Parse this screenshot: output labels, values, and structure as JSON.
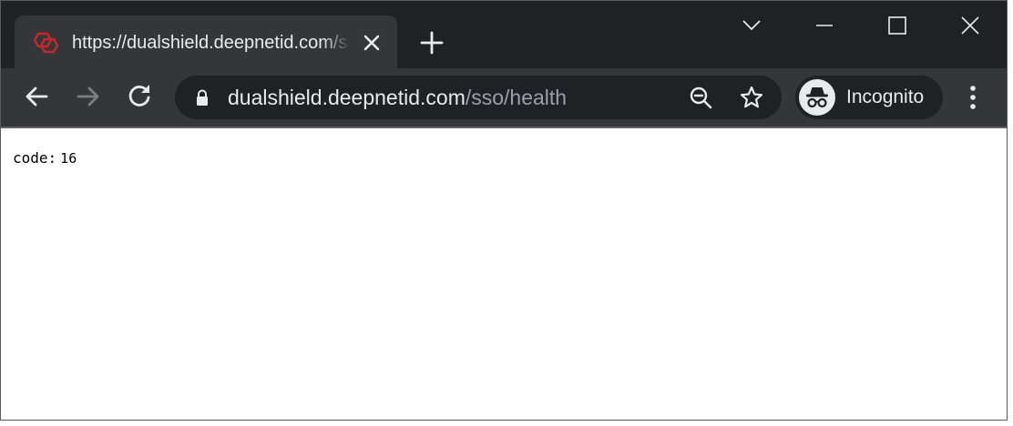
{
  "tab": {
    "title": "https://dualshield.deepnetid.com/sso/health",
    "favicon": "dualshield-logo-icon",
    "favicon_color": "#c62828"
  },
  "address_bar": {
    "host": "dualshield.deepnetid.com",
    "path": "/sso/health"
  },
  "profile": {
    "label": "Incognito"
  },
  "page": {
    "key": "code:",
    "value": "16"
  },
  "theme": {
    "frame": "#202124",
    "toolbar": "#35363a",
    "text": "#e8eaed",
    "muted": "#9aa0a6"
  }
}
